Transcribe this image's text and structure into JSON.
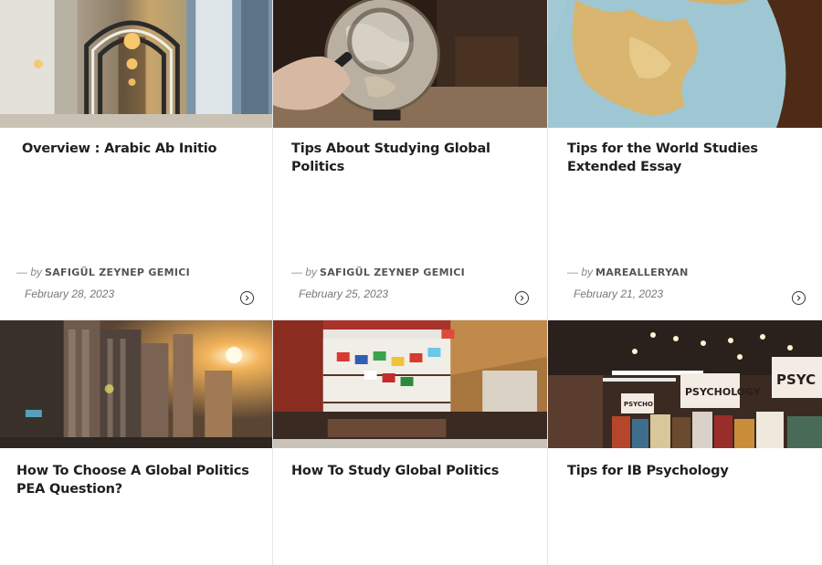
{
  "posts": [
    {
      "title": "Overview : Arabic Ab Initio",
      "by": "— by",
      "author": "SAFIGÜL ZEYNEP GEMICI",
      "date": "February 28, 2023",
      "image": "arabic-corridor-photo"
    },
    {
      "title": "Tips About Studying Global Politics",
      "by": "— by",
      "author": "SAFIGÜL ZEYNEP GEMICI",
      "date": "February 25, 2023",
      "image": "globe-magnifier-photo"
    },
    {
      "title": "Tips for the World Studies Extended Essay",
      "by": "— by",
      "author": "MAREALLERYAN",
      "date": "February 21, 2023",
      "image": "globe-europe-photo"
    },
    {
      "title": "How To Choose A Global Politics PEA Question?",
      "image": "city-sunset-photo"
    },
    {
      "title": "How To Study Global Politics",
      "image": "flags-street-photo"
    },
    {
      "title": "Tips for IB Psychology",
      "image": "psychology-bookstore-photo"
    }
  ]
}
